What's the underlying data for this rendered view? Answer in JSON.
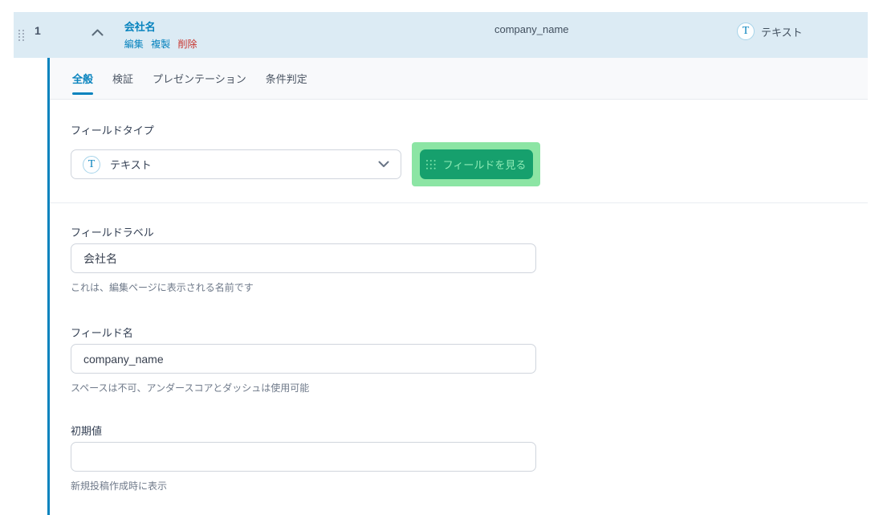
{
  "field_row": {
    "order": "1",
    "title": "会社名",
    "actions": {
      "edit": "編集",
      "duplicate": "複製",
      "delete": "削除"
    },
    "field_name": "company_name",
    "type": {
      "icon_letter": "T",
      "label": "テキスト"
    }
  },
  "tabs": [
    {
      "label": "全般",
      "active": true
    },
    {
      "label": "検証",
      "active": false
    },
    {
      "label": "プレゼンテーション",
      "active": false
    },
    {
      "label": "条件判定",
      "active": false
    }
  ],
  "form": {
    "field_type": {
      "label": "フィールドタイプ",
      "selected": "テキスト",
      "icon_letter": "T"
    },
    "browse_button": {
      "label": "フィールドを見る"
    },
    "field_label": {
      "label": "フィールドラベル",
      "value": "会社名",
      "hint": "これは、編集ページに表示される名前です"
    },
    "field_name": {
      "label": "フィールド名",
      "value": "company_name",
      "hint": "スペースは不可、アンダースコアとダッシュは使用可能"
    },
    "default_value": {
      "label": "初期値",
      "value": "",
      "hint": "新規投稿作成時に表示"
    }
  },
  "colors": {
    "accent_blue": "#0783be",
    "delete_red": "#c8322b",
    "header_bg": "#dcebf4",
    "button_green": "#16a06d",
    "highlight_green": "#8ce5a4"
  }
}
